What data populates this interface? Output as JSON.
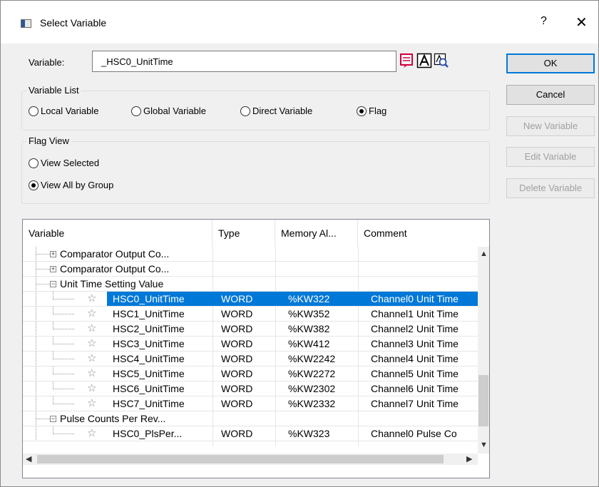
{
  "window": {
    "title": "Select Variable",
    "help": "?",
    "close": "✕"
  },
  "variable": {
    "label": "Variable:",
    "value": "_HSC0_UnitTime"
  },
  "variable_list": {
    "title": "Variable List",
    "options": [
      {
        "label": "Local Variable",
        "checked": false
      },
      {
        "label": "Global Variable",
        "checked": false
      },
      {
        "label": "Direct Variable",
        "checked": false
      },
      {
        "label": "Flag",
        "checked": true
      }
    ]
  },
  "flag_view": {
    "title": "Flag View",
    "options": [
      {
        "label": "View Selected",
        "checked": false
      },
      {
        "label": "View All by Group",
        "checked": true
      }
    ]
  },
  "buttons": {
    "ok": "OK",
    "cancel": "Cancel",
    "new": "New Variable",
    "edit": "Edit Variable",
    "delete": "Delete Variable"
  },
  "table": {
    "headers": [
      "Variable",
      "Type",
      "Memory Al...",
      "Comment"
    ],
    "rows": [
      {
        "kind": "group",
        "expander": "+",
        "label": "Comparator Output Co..."
      },
      {
        "kind": "group",
        "expander": "+",
        "label": "Comparator Output Co..."
      },
      {
        "kind": "group",
        "expander": "−",
        "label": "Unit Time Setting Value"
      },
      {
        "kind": "item",
        "label": "HSC0_UnitTime",
        "type": "WORD",
        "memory": "%KW322",
        "comment": "Channel0 Unit Time",
        "selected": true
      },
      {
        "kind": "item",
        "label": "HSC1_UnitTime",
        "type": "WORD",
        "memory": "%KW352",
        "comment": "Channel1 Unit Time"
      },
      {
        "kind": "item",
        "label": "HSC2_UnitTime",
        "type": "WORD",
        "memory": "%KW382",
        "comment": "Channel2 Unit Time"
      },
      {
        "kind": "item",
        "label": "HSC3_UnitTime",
        "type": "WORD",
        "memory": "%KW412",
        "comment": "Channel3 Unit Time"
      },
      {
        "kind": "item",
        "label": "HSC4_UnitTime",
        "type": "WORD",
        "memory": "%KW2242",
        "comment": "Channel4 Unit Time"
      },
      {
        "kind": "item",
        "label": "HSC5_UnitTime",
        "type": "WORD",
        "memory": "%KW2272",
        "comment": "Channel5 Unit Time"
      },
      {
        "kind": "item",
        "label": "HSC6_UnitTime",
        "type": "WORD",
        "memory": "%KW2302",
        "comment": "Channel6 Unit Time"
      },
      {
        "kind": "item",
        "label": "HSC7_UnitTime",
        "type": "WORD",
        "memory": "%KW2332",
        "comment": "Channel7 Unit Time"
      },
      {
        "kind": "group",
        "expander": "−",
        "label": "Pulse Counts Per Rev..."
      },
      {
        "kind": "item",
        "label": "HSC0_PlsPer...",
        "type": "WORD",
        "memory": "%KW323",
        "comment": "Channel0 Pulse Co"
      }
    ]
  },
  "icons": [
    "list-icon",
    "text-a-icon",
    "search-icon",
    "star-icon"
  ]
}
